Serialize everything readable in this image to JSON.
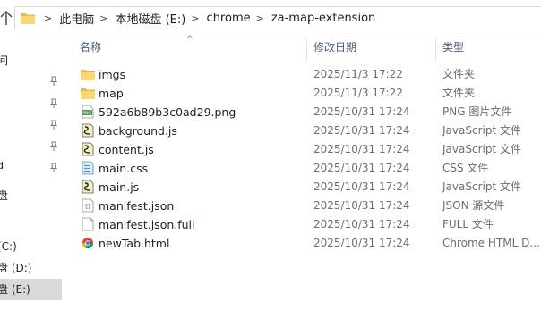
{
  "address_bar": {
    "breadcrumbs": [
      "此电脑",
      "本地磁盘 (E:)",
      "chrome",
      "za-map-extension"
    ],
    "separator": ">"
  },
  "nav": {
    "items": [
      {
        "label": "间",
        "pinned": false
      },
      {
        "label": "",
        "pinned": true
      },
      {
        "label": "",
        "pinned": true
      },
      {
        "label": "",
        "pinned": true
      },
      {
        "label": "",
        "pinned": true
      },
      {
        "label": "",
        "pinned": true
      },
      {
        "label": "盘",
        "pinned": false
      },
      {
        "label": "(C:)",
        "pinned": false
      },
      {
        "label": "盘 (D:)",
        "pinned": false
      },
      {
        "label": "盘 (E:)",
        "pinned": false,
        "selected": true
      }
    ]
  },
  "columns": {
    "name": "名称",
    "date": "修改日期",
    "type": "类型"
  },
  "files": [
    {
      "name": "imgs",
      "date": "2025/11/3 17:22",
      "type": "文件夹",
      "icon": "folder-icon"
    },
    {
      "name": "map",
      "date": "2025/11/3 17:22",
      "type": "文件夹",
      "icon": "folder-icon"
    },
    {
      "name": "592a6b89b3c0ad29.png",
      "date": "2025/10/31 17:24",
      "type": "PNG 图片文件",
      "icon": "png-file-icon"
    },
    {
      "name": "background.js",
      "date": "2025/10/31 17:24",
      "type": "JavaScript 文件",
      "icon": "js-file-icon"
    },
    {
      "name": "content.js",
      "date": "2025/10/31 17:24",
      "type": "JavaScript 文件",
      "icon": "js-file-icon"
    },
    {
      "name": "main.css",
      "date": "2025/10/31 17:24",
      "type": "CSS 文件",
      "icon": "css-file-icon"
    },
    {
      "name": "main.js",
      "date": "2025/10/31 17:24",
      "type": "JavaScript 文件",
      "icon": "js-file-icon"
    },
    {
      "name": "manifest.json",
      "date": "2025/10/31 17:24",
      "type": "JSON 源文件",
      "icon": "json-file-icon"
    },
    {
      "name": "manifest.json.full",
      "date": "2025/10/31 17:24",
      "type": "FULL 文件",
      "icon": "blank-file-icon"
    },
    {
      "name": "newTab.html",
      "date": "2025/10/31 17:24",
      "type": "Chrome HTML D...",
      "icon": "chrome-html-icon"
    }
  ],
  "colors": {
    "folder": "#e8b84a",
    "selected_nav": "#d9d9d9",
    "header_text": "#4c607a",
    "meta_text": "#6d6d6d"
  }
}
